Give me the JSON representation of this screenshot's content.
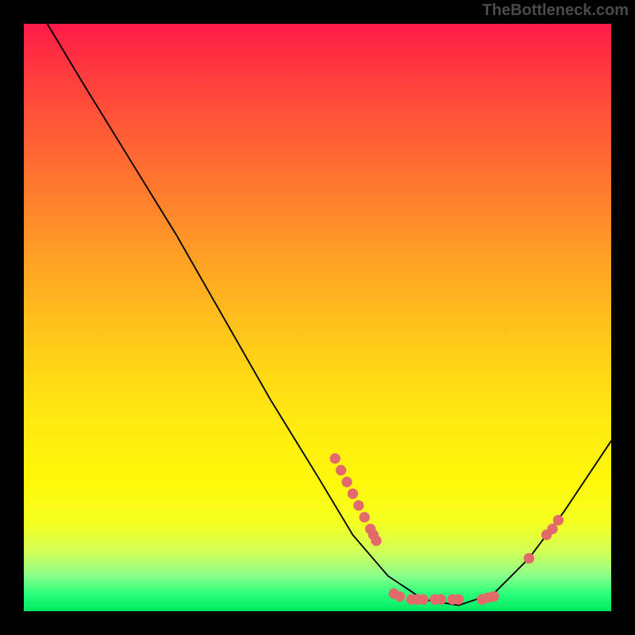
{
  "attribution": "TheBottleneck.com",
  "chart_data": {
    "type": "line",
    "title": "",
    "xlabel": "",
    "ylabel": "",
    "xlim": [
      0,
      100
    ],
    "ylim": [
      0,
      100
    ],
    "curve": [
      {
        "x": 4,
        "y": 100
      },
      {
        "x": 10,
        "y": 90
      },
      {
        "x": 18,
        "y": 77
      },
      {
        "x": 26,
        "y": 64
      },
      {
        "x": 34,
        "y": 50
      },
      {
        "x": 42,
        "y": 36
      },
      {
        "x": 50,
        "y": 23
      },
      {
        "x": 56,
        "y": 13
      },
      {
        "x": 62,
        "y": 6
      },
      {
        "x": 68,
        "y": 2
      },
      {
        "x": 74,
        "y": 1
      },
      {
        "x": 80,
        "y": 3
      },
      {
        "x": 86,
        "y": 9
      },
      {
        "x": 92,
        "y": 17
      },
      {
        "x": 100,
        "y": 29
      }
    ],
    "points": [
      {
        "x": 53,
        "y": 26
      },
      {
        "x": 54,
        "y": 24
      },
      {
        "x": 55,
        "y": 22
      },
      {
        "x": 56,
        "y": 20
      },
      {
        "x": 57,
        "y": 18
      },
      {
        "x": 58,
        "y": 16
      },
      {
        "x": 59,
        "y": 14
      },
      {
        "x": 59.5,
        "y": 13
      },
      {
        "x": 60,
        "y": 12
      },
      {
        "x": 63,
        "y": 3
      },
      {
        "x": 64,
        "y": 2.5
      },
      {
        "x": 66,
        "y": 2
      },
      {
        "x": 67,
        "y": 2
      },
      {
        "x": 68,
        "y": 2
      },
      {
        "x": 70,
        "y": 2
      },
      {
        "x": 71,
        "y": 2
      },
      {
        "x": 73,
        "y": 2
      },
      {
        "x": 74,
        "y": 2
      },
      {
        "x": 78,
        "y": 2
      },
      {
        "x": 79,
        "y": 2.3
      },
      {
        "x": 80,
        "y": 2.5
      },
      {
        "x": 86,
        "y": 9
      },
      {
        "x": 89,
        "y": 13
      },
      {
        "x": 90,
        "y": 14
      },
      {
        "x": 91,
        "y": 15.5
      }
    ],
    "colors": {
      "curve": "#000000",
      "points": "#e36a6a"
    }
  }
}
